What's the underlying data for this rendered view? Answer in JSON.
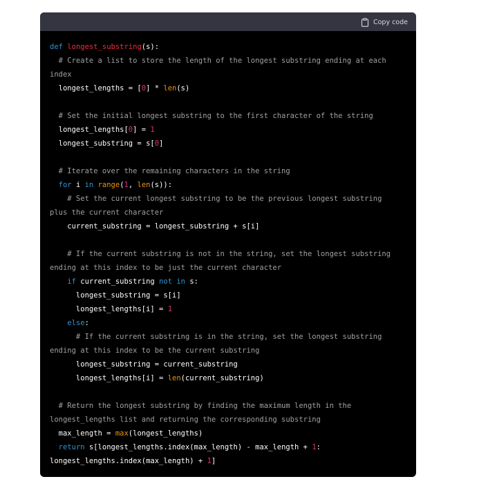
{
  "copy_button": {
    "label": "Copy code",
    "icon": "clipboard-icon"
  },
  "colors": {
    "background": "#000000",
    "header": "#343541",
    "keyword": "#2e95d3",
    "function_name": "#f22c3d",
    "number": "#df3079",
    "builtin": "#e9950c",
    "comment": "#a0a0a0",
    "text": "#ffffff"
  },
  "code_lines": [
    [
      [
        "kw",
        "def"
      ],
      [
        "t",
        " "
      ],
      [
        "fn",
        "longest_substring"
      ],
      [
        "t",
        "(s):"
      ]
    ],
    [
      [
        "cm",
        "  # Create a list to store the length of the longest substring ending at each"
      ]
    ],
    [
      [
        "cm",
        "index"
      ]
    ],
    [
      [
        "t",
        "  longest_lengths = ["
      ],
      [
        "num",
        "0"
      ],
      [
        "t",
        "] * "
      ],
      [
        "bi",
        "len"
      ],
      [
        "t",
        "(s)"
      ]
    ],
    [],
    [
      [
        "cm",
        "  # Set the initial longest substring to the first character of the string"
      ]
    ],
    [
      [
        "t",
        "  longest_lengths["
      ],
      [
        "num",
        "0"
      ],
      [
        "t",
        "] = "
      ],
      [
        "num",
        "1"
      ]
    ],
    [
      [
        "t",
        "  longest_substring = s["
      ],
      [
        "num",
        "0"
      ],
      [
        "t",
        "]"
      ]
    ],
    [],
    [
      [
        "cm",
        "  # Iterate over the remaining characters in the string"
      ]
    ],
    [
      [
        "t",
        "  "
      ],
      [
        "kw",
        "for"
      ],
      [
        "t",
        " i "
      ],
      [
        "kw",
        "in"
      ],
      [
        "t",
        " "
      ],
      [
        "bi",
        "range"
      ],
      [
        "t",
        "("
      ],
      [
        "num",
        "1"
      ],
      [
        "t",
        ", "
      ],
      [
        "bi",
        "len"
      ],
      [
        "t",
        "(s)):"
      ]
    ],
    [
      [
        "cm",
        "    # Set the current longest substring to be the previous longest substring"
      ]
    ],
    [
      [
        "cm",
        "plus the current character"
      ]
    ],
    [
      [
        "t",
        "    current_substring = longest_substring + s[i]"
      ]
    ],
    [],
    [
      [
        "cm",
        "    # If the current substring is not in the string, set the longest substring"
      ]
    ],
    [
      [
        "cm",
        "ending at this index to be just the current character"
      ]
    ],
    [
      [
        "t",
        "    "
      ],
      [
        "kw",
        "if"
      ],
      [
        "t",
        " current_substring "
      ],
      [
        "kw",
        "not in"
      ],
      [
        "t",
        " s:"
      ]
    ],
    [
      [
        "t",
        "      longest_substring = s[i]"
      ]
    ],
    [
      [
        "t",
        "      longest_lengths[i] = "
      ],
      [
        "num",
        "1"
      ]
    ],
    [
      [
        "t",
        "    "
      ],
      [
        "kw",
        "else"
      ],
      [
        "t",
        ":"
      ]
    ],
    [
      [
        "cm",
        "      # If the current substring is in the string, set the longest substring"
      ]
    ],
    [
      [
        "cm",
        "ending at this index to be the current substring"
      ]
    ],
    [
      [
        "t",
        "      longest_substring = current_substring"
      ]
    ],
    [
      [
        "t",
        "      longest_lengths[i] = "
      ],
      [
        "bi",
        "len"
      ],
      [
        "t",
        "(current_substring)"
      ]
    ],
    [],
    [
      [
        "cm",
        "  # Return the longest substring by finding the maximum length in the"
      ]
    ],
    [
      [
        "cm",
        "longest_lengths list and returning the corresponding substring"
      ]
    ],
    [
      [
        "t",
        "  max_length = "
      ],
      [
        "bi",
        "max"
      ],
      [
        "t",
        "(longest_lengths)"
      ]
    ],
    [
      [
        "t",
        "  "
      ],
      [
        "kw",
        "return"
      ],
      [
        "t",
        " s[longest_lengths.index(max_length) - max_length + "
      ],
      [
        "num",
        "1"
      ],
      [
        "t",
        ":"
      ]
    ],
    [
      [
        "t",
        "longest_lengths.index(max_length) + "
      ],
      [
        "num",
        "1"
      ],
      [
        "t",
        "]"
      ]
    ]
  ]
}
